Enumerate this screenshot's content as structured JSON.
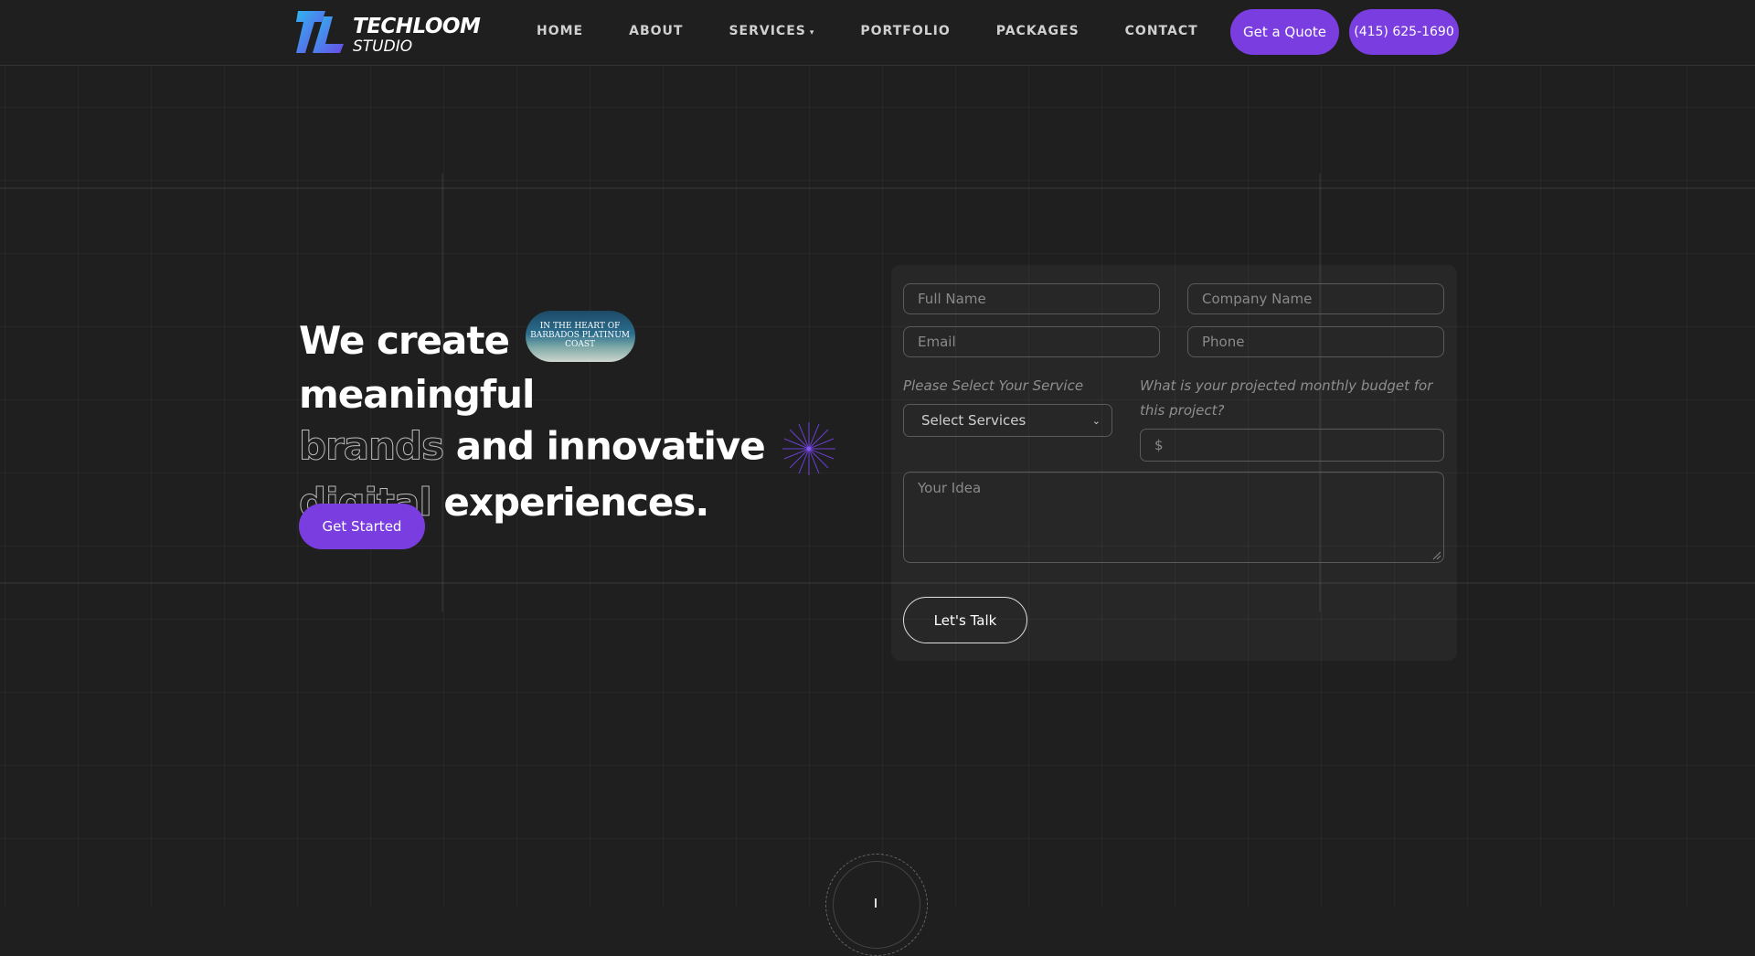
{
  "brand": {
    "name_line1": "TECHLOOM",
    "name_line2": "STUDIO"
  },
  "nav": {
    "items": [
      {
        "label": "HOME"
      },
      {
        "label": "ABOUT"
      },
      {
        "label": "SERVICES"
      },
      {
        "label": "PORTFOLIO"
      },
      {
        "label": "PACKAGES"
      },
      {
        "label": "CONTACT"
      }
    ],
    "quote_label": "Get a Quote",
    "phone_label": "(415) 625-1690"
  },
  "hero": {
    "headline_part1": "We create",
    "headline_part2": "meaningful",
    "headline_outline1": "brands",
    "headline_part3": "and innovative",
    "headline_outline2": "digital",
    "headline_part4": "experiences.",
    "pill_image_text": "IN THE HEART OF BARBADOS PLATINUM COAST",
    "cta_label": "Get Started"
  },
  "form": {
    "full_name_placeholder": "Full Name",
    "company_placeholder": "Company Name",
    "email_placeholder": "Email",
    "phone_placeholder": "Phone",
    "service_label": "Please Select Your Service",
    "service_selected": "Select Services",
    "budget_label": "What is your projected monthly budget for this project?",
    "budget_symbol": "$",
    "idea_placeholder": "Your Idea",
    "submit_label": "Let's Talk"
  },
  "colors": {
    "accent": "#7a3ee0",
    "background": "#1f1f1f"
  }
}
